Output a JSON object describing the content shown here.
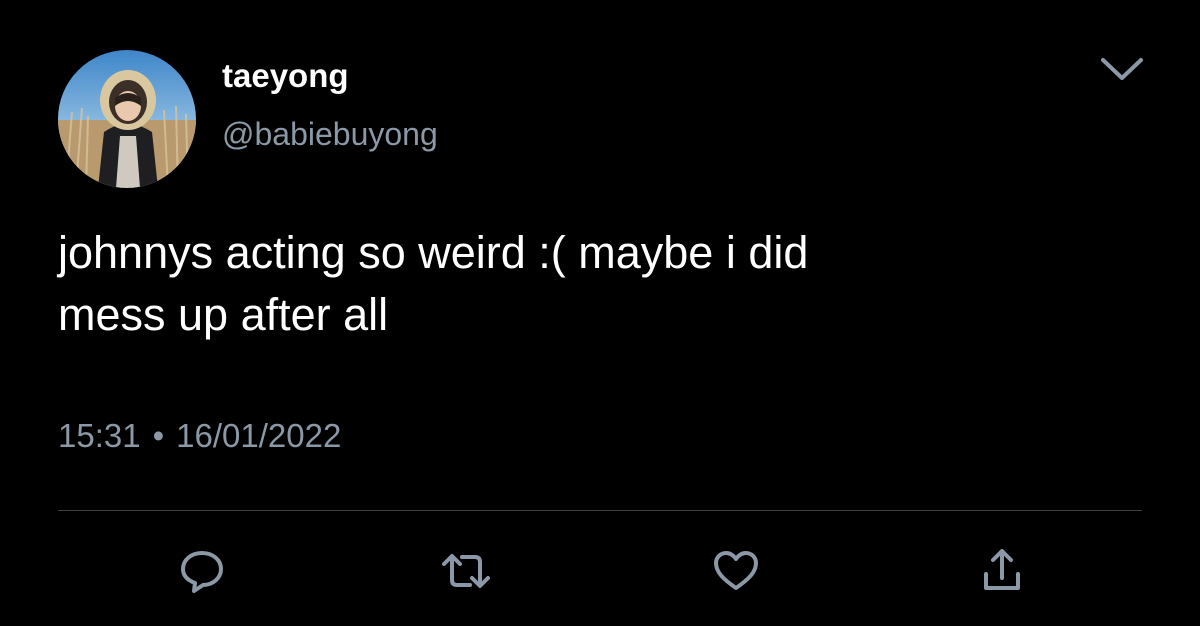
{
  "user": {
    "display_name": "taeyong",
    "handle": "@babiebuyong",
    "avatar_icon": "profile-photo"
  },
  "tweet": {
    "text": "johnnys acting so weird :( maybe i did\nmess up after all",
    "time": "15:31",
    "separator": "•",
    "date": "16/01/2022"
  },
  "actions": [
    {
      "name": "reply",
      "icon": "speech-bubble-icon"
    },
    {
      "name": "retweet",
      "icon": "retweet-arrows-icon"
    },
    {
      "name": "like",
      "icon": "heart-icon"
    },
    {
      "name": "share",
      "icon": "share-upload-icon"
    }
  ],
  "colors": {
    "background": "#000000",
    "text": "#ffffff",
    "secondary": "#8b98a5",
    "divider": "#3a3f44"
  }
}
